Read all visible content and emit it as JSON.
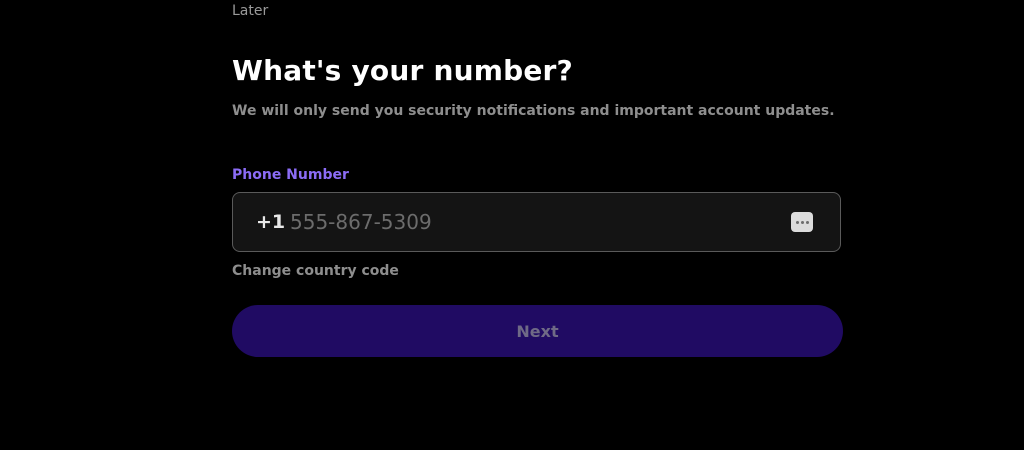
{
  "header": {
    "later_label": "Later"
  },
  "main": {
    "title": "What's your number?",
    "subtitle": "We will only send you security notifications and important account updates."
  },
  "phone": {
    "label": "Phone Number",
    "country_code": "+1",
    "placeholder": "555-867-5309",
    "value": "",
    "autofill_icon": "more-dots-icon",
    "change_country_label": "Change country code"
  },
  "actions": {
    "next_label": "Next"
  },
  "colors": {
    "background": "#000000",
    "accent_label": "#8b6cf6",
    "button_bg": "#200b63",
    "button_text": "#6f6a86"
  }
}
